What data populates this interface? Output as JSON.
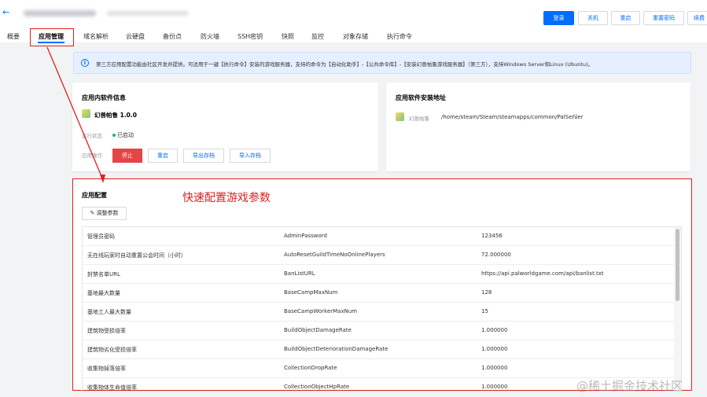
{
  "header": {
    "buttons": {
      "login": "登录",
      "shutdown": "关机",
      "restart": "重启",
      "reset_password": "重置密码",
      "more": "续费"
    }
  },
  "tabs": [
    "概要",
    "应用管理",
    "域名解析",
    "云硬盘",
    "备份点",
    "防火墙",
    "SSH密钥",
    "快照",
    "监控",
    "对象存储",
    "执行命令"
  ],
  "notice": {
    "text": "第三方应用配置功能由社区开发并提供。可适用于一键【执行命令】安装的游戏服务器，支持的命令为【自动化助手】-【公共命令库】-【安装幻兽帕鲁游戏服务器】（第三方），支持Windows Server和Linux (Ubuntu)。"
  },
  "app_info": {
    "title": "应用内软件信息",
    "app_name": "幻兽帕鲁 1.0.0",
    "status_label": "运行状态",
    "status_value": "已启动",
    "ops_label": "应用操作",
    "buttons": {
      "stop": "停止",
      "restart": "重启",
      "export": "导出存档",
      "import": "导入存档"
    }
  },
  "install_path": {
    "title": "应用软件安装地址",
    "app_label": "幻兽帕鲁",
    "path": "/home/steam/Steam/steamapps/common/PalServer"
  },
  "config": {
    "title": "应用配置",
    "annotation": "快速配置游戏参数",
    "adjust_button": "调整参数",
    "rows": [
      {
        "name": "管理员密码",
        "key": "AdminPassword",
        "value": "123456"
      },
      {
        "name": "无在线玩家时自动重置公会时间（小时）",
        "key": "AutoResetGuildTimeNoOnlinePlayers",
        "value": "72.000000"
      },
      {
        "name": "封禁名单URL",
        "key": "BanListURL",
        "value": "https://api.palworldgame.com/api/banlist.txt"
      },
      {
        "name": "基地最大数量",
        "key": "BaseCampMaxNum",
        "value": "128"
      },
      {
        "name": "基地工人最大数量",
        "key": "BaseCampWorkerMaxNum",
        "value": "15"
      },
      {
        "name": "建筑物受损倍率",
        "key": "BuildObjectDamageRate",
        "value": "1.000000"
      },
      {
        "name": "建筑物劣化受损倍率",
        "key": "BuildObjectDeteriorationDamageRate",
        "value": "1.000000"
      },
      {
        "name": "收集物掉落倍率",
        "key": "CollectionDropRate",
        "value": "1.000000"
      },
      {
        "name": "收集物体生命值倍率",
        "key": "CollectionObjectHpRate",
        "value": "1.000000"
      }
    ]
  },
  "watermark": "@稀土掘金技术社区",
  "colors": {
    "accent": "#006eff",
    "annotation_red": "#e02020",
    "danger": "#e54545",
    "success": "#0abf5b"
  }
}
